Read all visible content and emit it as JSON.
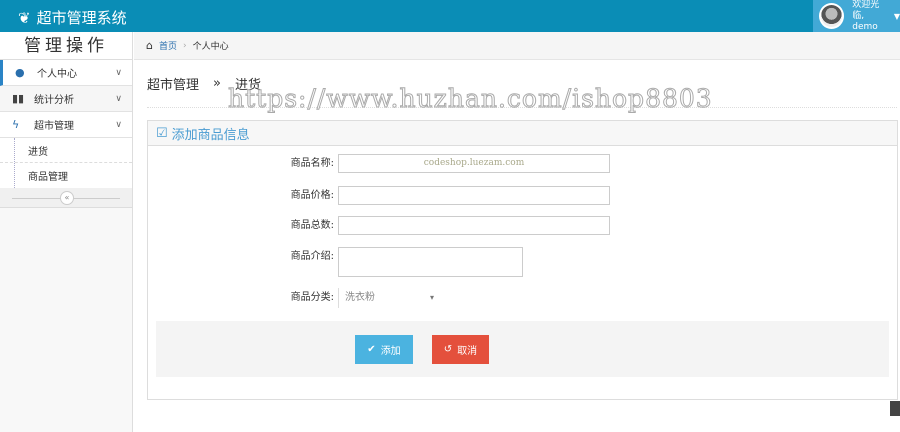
{
  "header": {
    "title": "超市管理系统",
    "user_greeting": "欢迎光临,",
    "username": "demo"
  },
  "sidebar": {
    "title": "管理操作",
    "items": [
      {
        "label": "个人中心",
        "icon": "user-icon"
      },
      {
        "label": "统计分析",
        "icon": "bar-chart-icon"
      },
      {
        "label": "超市管理",
        "icon": "bolt-icon"
      }
    ],
    "subitems": [
      {
        "label": "进货"
      },
      {
        "label": "商品管理"
      }
    ],
    "collapse_label": "«"
  },
  "breadcrumb": {
    "home": "首页",
    "current": "个人中心"
  },
  "page": {
    "section": "超市管理",
    "separator": "»",
    "title": "进货"
  },
  "watermarks": [
    "https://www.huzhan.com/ishop8803",
    "codeshop.luezam.com"
  ],
  "panel": {
    "title": "添加商品信息"
  },
  "form": {
    "name_label": "商品名称:",
    "price_label": "商品价格:",
    "count_label": "商品总数:",
    "desc_label": "商品介绍:",
    "category_label": "商品分类:",
    "category_value": "洗衣粉"
  },
  "buttons": {
    "add": "添加",
    "cancel": "取消"
  },
  "colors": {
    "topbar": "#0a8db6",
    "add": "#4bb3e0",
    "cancel": "#e4503c"
  }
}
